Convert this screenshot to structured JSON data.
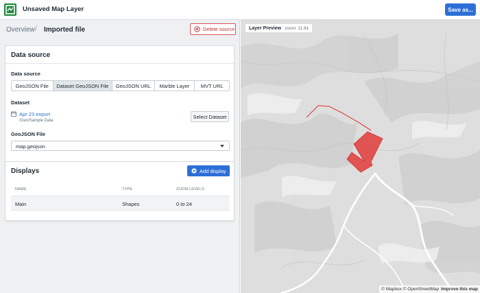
{
  "app": {
    "title": "Unsaved Map Layer",
    "save_label": "Save as...",
    "accent": "#2d6fd6",
    "icon": "map-layer-icon"
  },
  "breadcrumb": {
    "overview": "Overview",
    "separator": "/",
    "current": "Imported file"
  },
  "delete_label": "Delete source",
  "data_source": {
    "title": "Data source",
    "section_label": "Data source",
    "options": [
      "GeoJSON File",
      "Dataset GeoJSON File",
      "GeoJSON URL",
      "Marble Layer",
      "MVT URL"
    ],
    "selected": "Dataset GeoJSON File",
    "dataset_label": "Dataset",
    "dataset_name": "Apr 23 export",
    "dataset_path": "/Geo/Sample Data",
    "select_dataset_label": "Select Dataset",
    "file_label": "GeoJSON File",
    "file_value": "map.geojson"
  },
  "displays": {
    "title": "Displays",
    "add_label": "Add display",
    "columns": [
      "NAME",
      "TYPE",
      "ZOOM LEVELS"
    ],
    "rows": [
      {
        "name": "Main",
        "type": "Shapes",
        "zoom": "0 to 24"
      }
    ]
  },
  "map": {
    "preview_label": "Layer Preview",
    "zoom_text": "zoom: 11.81",
    "attribution": "© Mapbox © OpenStreetMap",
    "improve": "Improve this map",
    "feature_color": "#e03c3c"
  }
}
